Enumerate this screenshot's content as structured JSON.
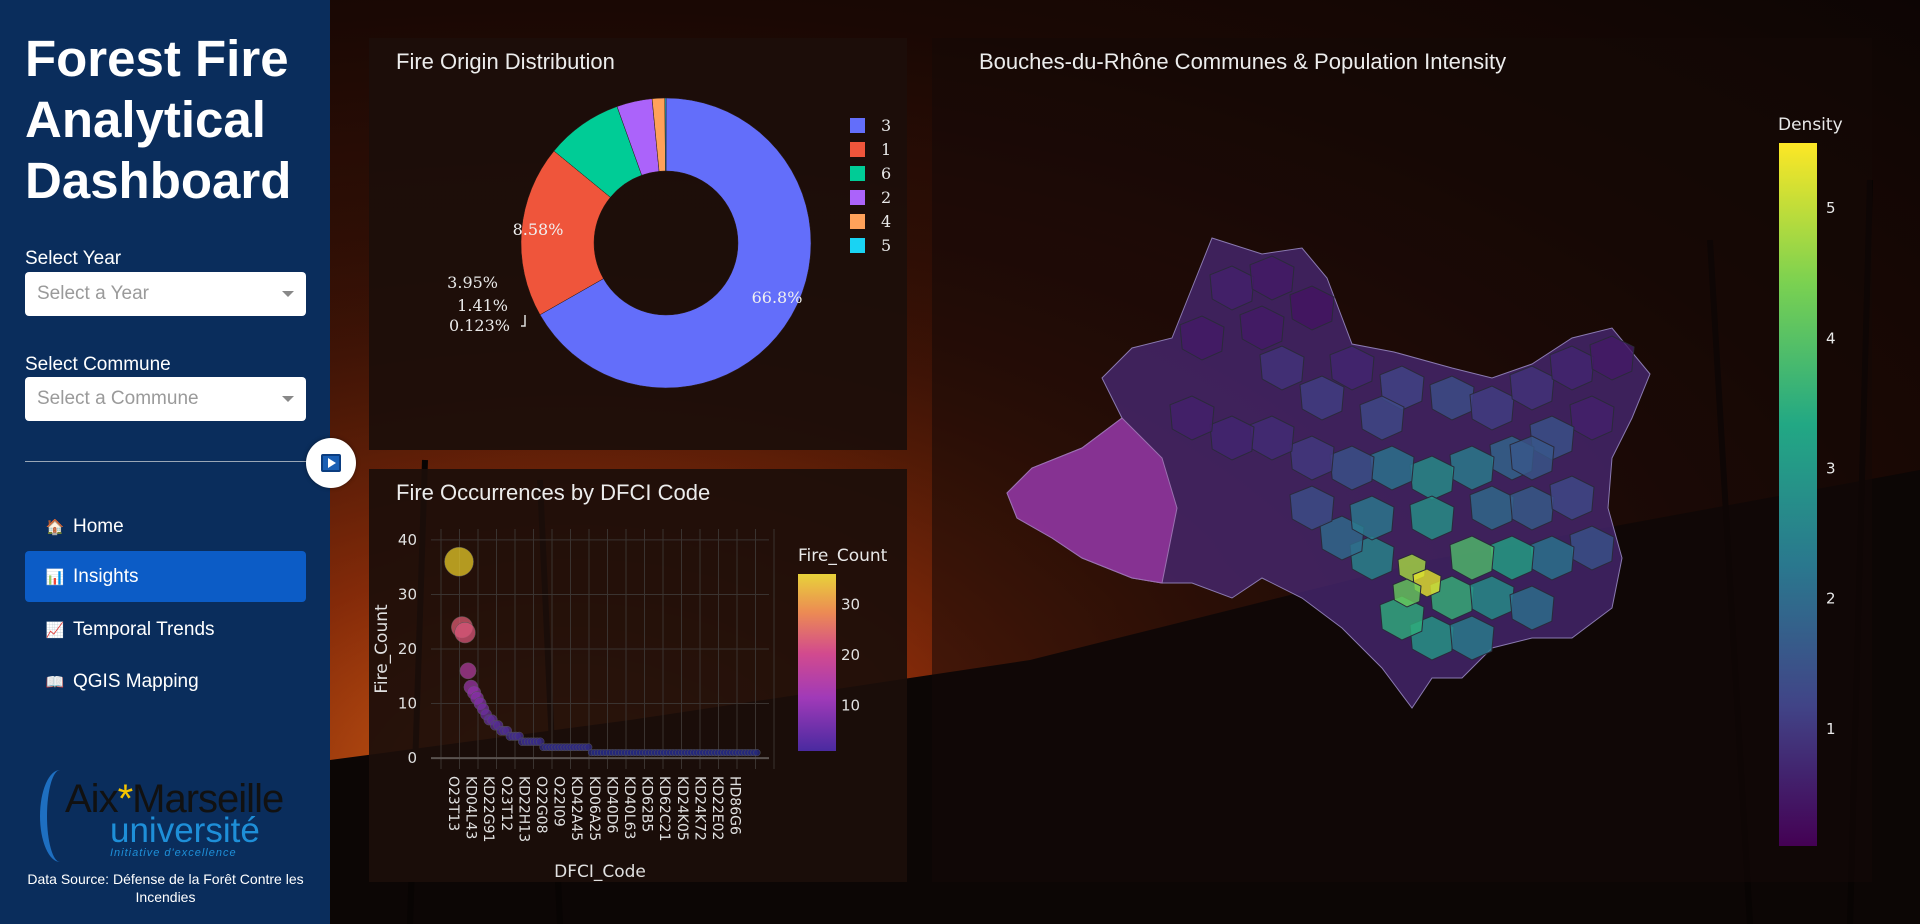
{
  "sidebar": {
    "title_line1": "Forest Fire",
    "title_line2": "Analytical",
    "title_line3": "Dashboard",
    "year_label": "Select Year",
    "year_placeholder": "Select a Year",
    "commune_label": "Select Commune",
    "commune_placeholder": "Select a Commune",
    "nav": [
      {
        "label": "Home",
        "icon": "home-icon",
        "glyph": "🏠"
      },
      {
        "label": "Insights",
        "icon": "bar-chart-icon",
        "glyph": "📊"
      },
      {
        "label": "Temporal Trends",
        "icon": "trend-chart-icon",
        "glyph": "📈"
      },
      {
        "label": "QGIS Mapping",
        "icon": "map-book-icon",
        "glyph": "📖"
      }
    ],
    "logo_text1": "Aix",
    "logo_star": "*",
    "logo_text2": "Marseille",
    "logo_text3": "université",
    "logo_text4": "Initiative d'excellence",
    "source": "Data Source: Défense de la Forêt Contre les Incendies"
  },
  "panels": {
    "pie_title": "Fire Origin Distribution",
    "scatter_title": "Fire Occurrences by DFCI Code",
    "map_title": "Bouches-du-Rhône Communes & Population Intensity"
  },
  "colors": {
    "sidebar": "#0a2d5c",
    "active_nav": "#0c5cc6"
  },
  "chart_data": [
    {
      "type": "pie",
      "title": "Fire Origin Distribution",
      "donut": true,
      "legend_position": "right",
      "slices": [
        {
          "label": "3",
          "value": 66.8,
          "text": "66.8%",
          "color": "#636efa"
        },
        {
          "label": "1",
          "value": 19.2,
          "text": "19.2%",
          "color": "#ef553b"
        },
        {
          "label": "6",
          "value": 8.58,
          "text": "8.58%",
          "color": "#00cc96"
        },
        {
          "label": "2",
          "value": 3.95,
          "text": "3.95%",
          "color": "#ab63fa"
        },
        {
          "label": "4",
          "value": 1.41,
          "text": "1.41%",
          "color": "#ffa15a"
        },
        {
          "label": "5",
          "value": 0.123,
          "text": "0.123%",
          "color": "#19d3f3"
        }
      ]
    },
    {
      "type": "scatter",
      "title": "Fire Occurrences by DFCI Code",
      "xlabel": "DFCI_Code",
      "ylabel": "Fire_Count",
      "yticks": [
        0,
        10,
        20,
        30,
        40
      ],
      "ylim": [
        -2,
        42
      ],
      "grid": true,
      "colorbar": {
        "title": "Fire_Count",
        "ticks": [
          10,
          20,
          30
        ],
        "range": [
          1,
          36
        ]
      },
      "x_tick_labels": [
        "O23T13",
        "KD04L43",
        "KD22G91",
        "O23T12",
        "KD22H13",
        "O22G08",
        "O22I09",
        "KD42A45",
        "KD06A25",
        "KD40D6",
        "KD40L63",
        "KD62B5",
        "KD62C21",
        "KD24K05",
        "KD24K72",
        "KD22E02",
        "HD86G6"
      ],
      "y": [
        36,
        24,
        23,
        16,
        13,
        12,
        11,
        10,
        9,
        8,
        7,
        7,
        6,
        6,
        5,
        5,
        5,
        4,
        4,
        4,
        4,
        3,
        3,
        3,
        3,
        3,
        3,
        3,
        2,
        2,
        2,
        2,
        2,
        2,
        2,
        2,
        2,
        2,
        2,
        2,
        2,
        2,
        2,
        2,
        1,
        1,
        1,
        1,
        1,
        1,
        1,
        1,
        1,
        1,
        1,
        1,
        1,
        1,
        1,
        1,
        1,
        1,
        1,
        1,
        1,
        1,
        1,
        1,
        1,
        1,
        1,
        1,
        1,
        1,
        1,
        1,
        1,
        1,
        1,
        1,
        1,
        1,
        1,
        1,
        1,
        1,
        1,
        1,
        1,
        1,
        1,
        1,
        1,
        1,
        1,
        1,
        1,
        1,
        1,
        1
      ]
    },
    {
      "type": "heatmap",
      "title": "Bouches-du-Rhône Communes & Population Intensity",
      "colorbar": {
        "title": "Density",
        "ticks": [
          1,
          2,
          3,
          4,
          5
        ],
        "range": [
          0.1,
          5.5
        ]
      }
    }
  ]
}
